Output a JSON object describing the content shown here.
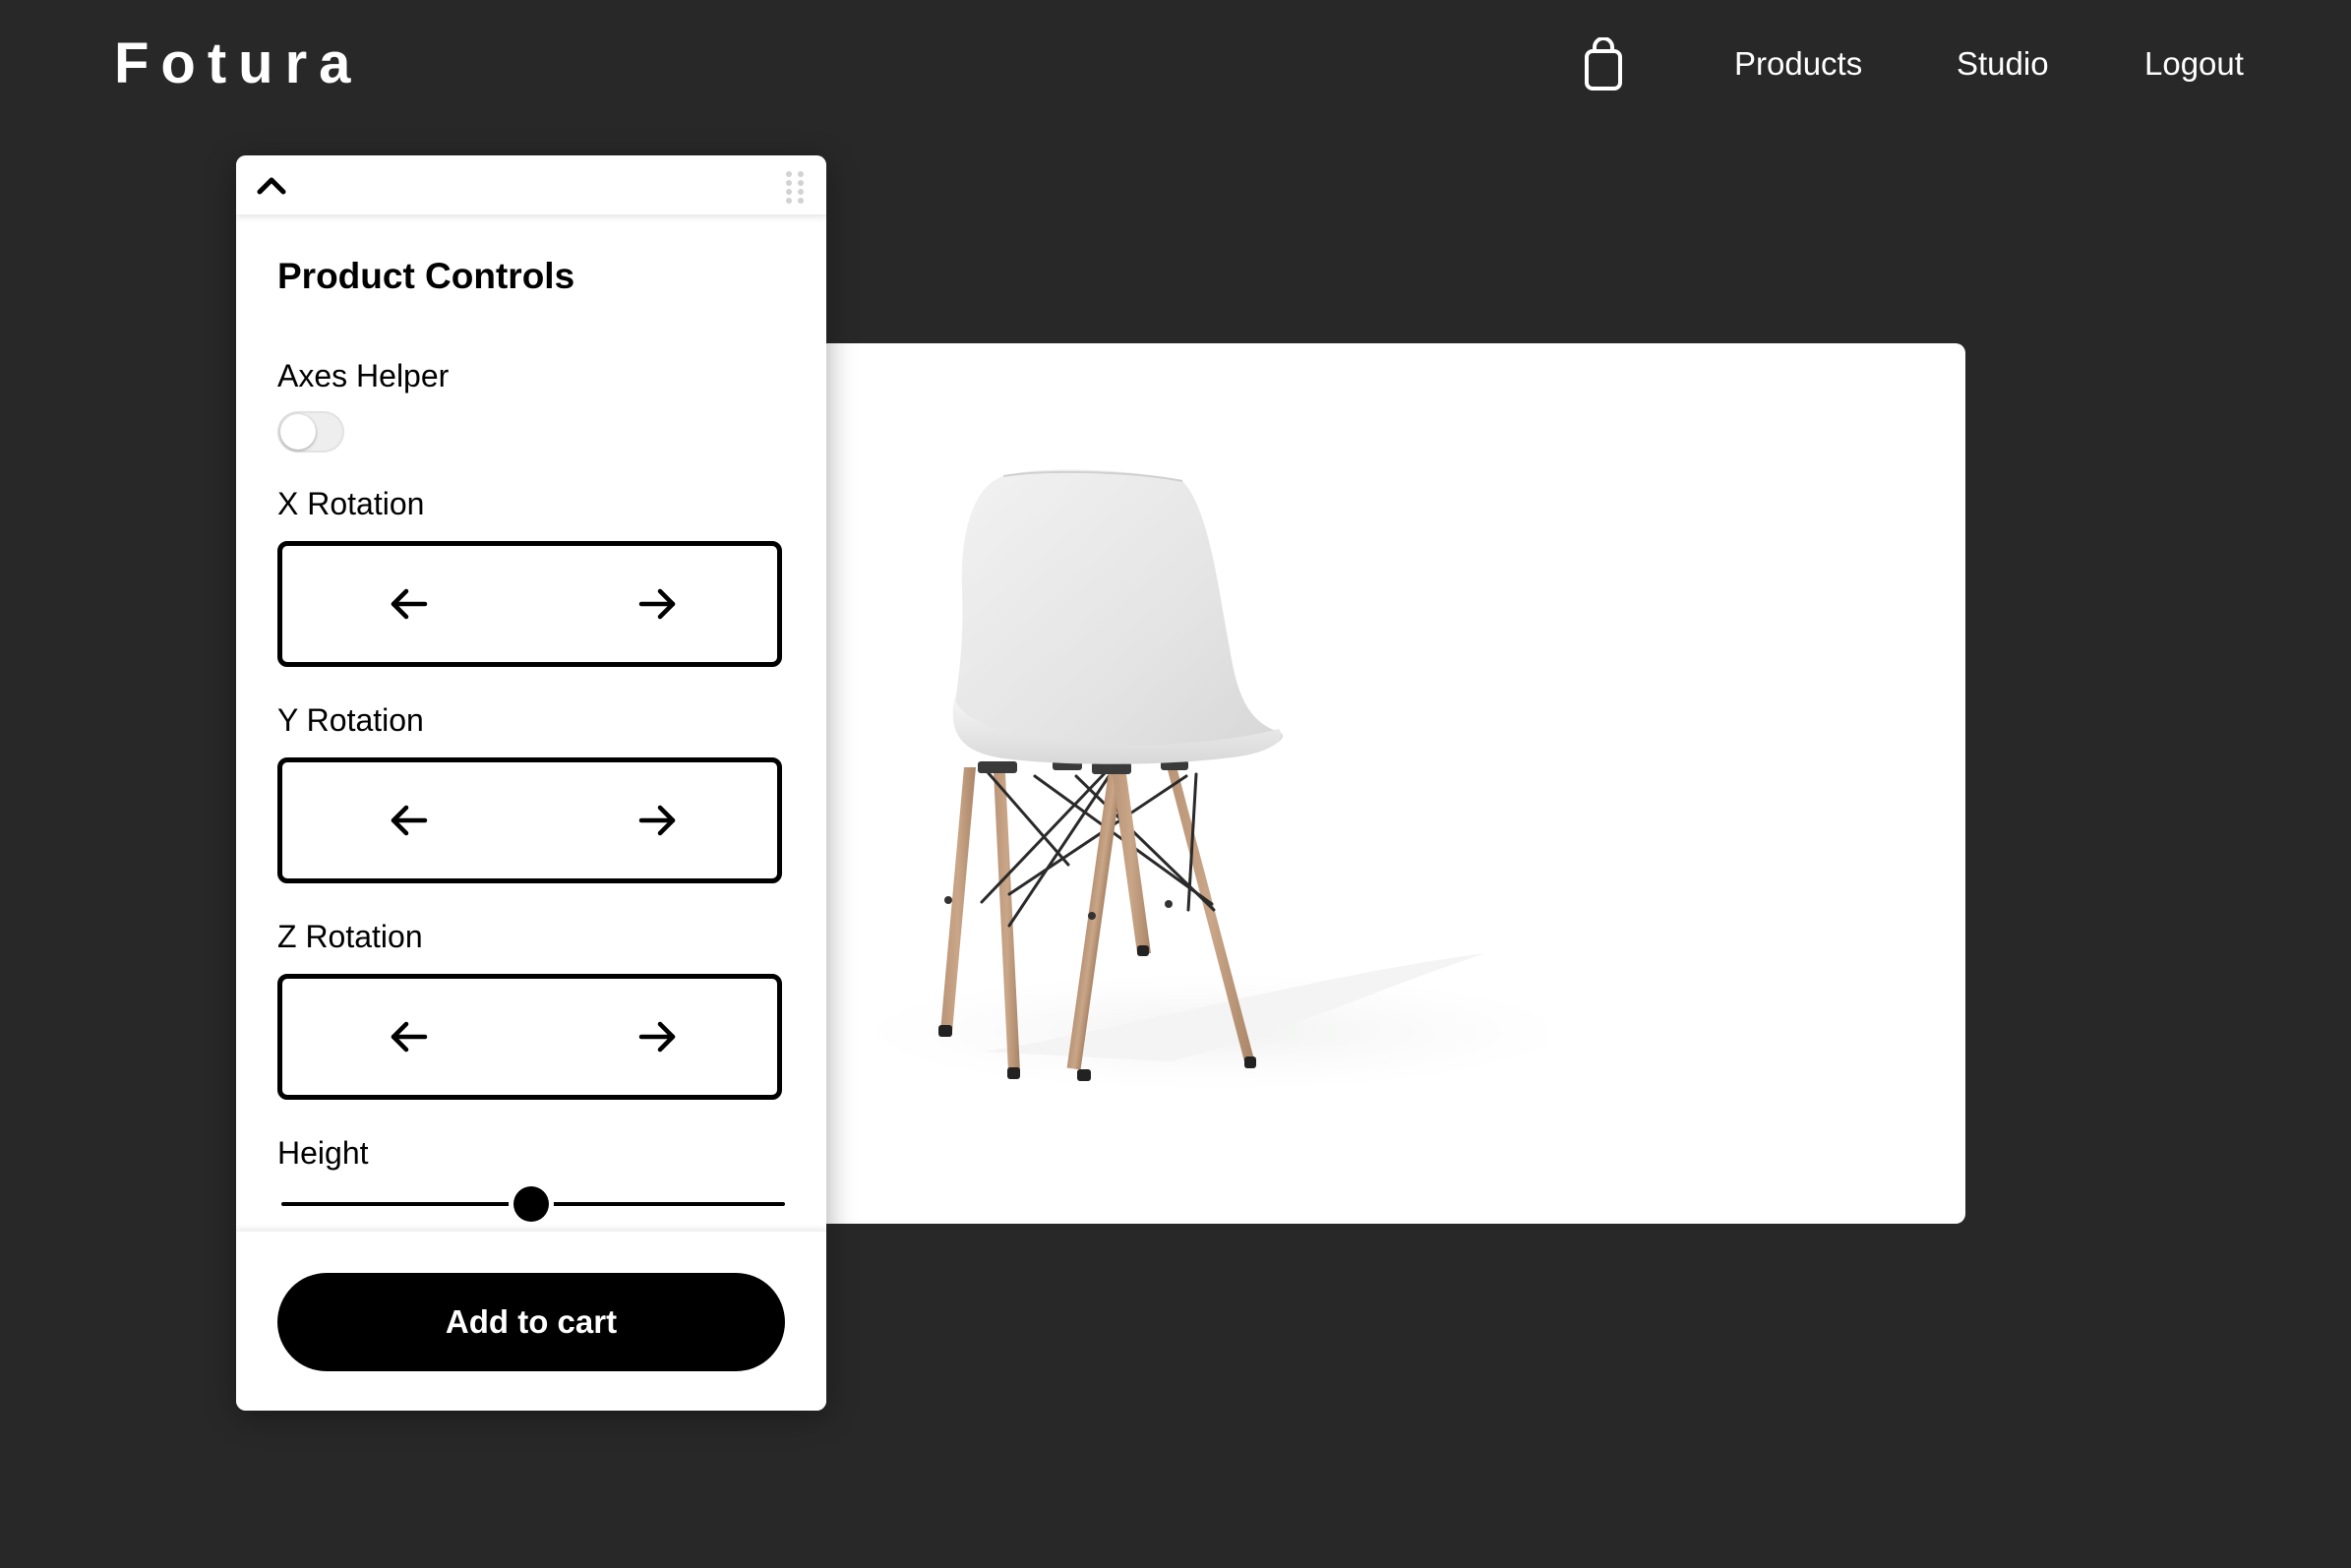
{
  "header": {
    "logo": "Fotura",
    "cart_icon": "shopping-bag-icon",
    "nav": [
      {
        "label": "Products"
      },
      {
        "label": "Studio"
      },
      {
        "label": "Logout"
      }
    ]
  },
  "panel": {
    "collapse_icon": "chevron-up-icon",
    "drag_icon": "drag-handle-icon",
    "title": "Product Controls",
    "axes_helper": {
      "label": "Axes Helper",
      "enabled": false
    },
    "x_rotation": {
      "label": "X Rotation",
      "left_icon": "arrow-left-icon",
      "right_icon": "arrow-right-icon"
    },
    "y_rotation": {
      "label": "Y Rotation",
      "left_icon": "arrow-left-icon",
      "right_icon": "arrow-right-icon"
    },
    "z_rotation": {
      "label": "Z Rotation",
      "left_icon": "arrow-left-icon",
      "right_icon": "arrow-right-icon"
    },
    "height": {
      "label": "Height",
      "value_fraction": 0.5
    },
    "add_to_cart_label": "Add to cart"
  },
  "viewer": {
    "product": "chair"
  },
  "colors": {
    "background": "#282828",
    "panel": "#ffffff",
    "accent": "#000000",
    "text_light": "#ffffff"
  }
}
